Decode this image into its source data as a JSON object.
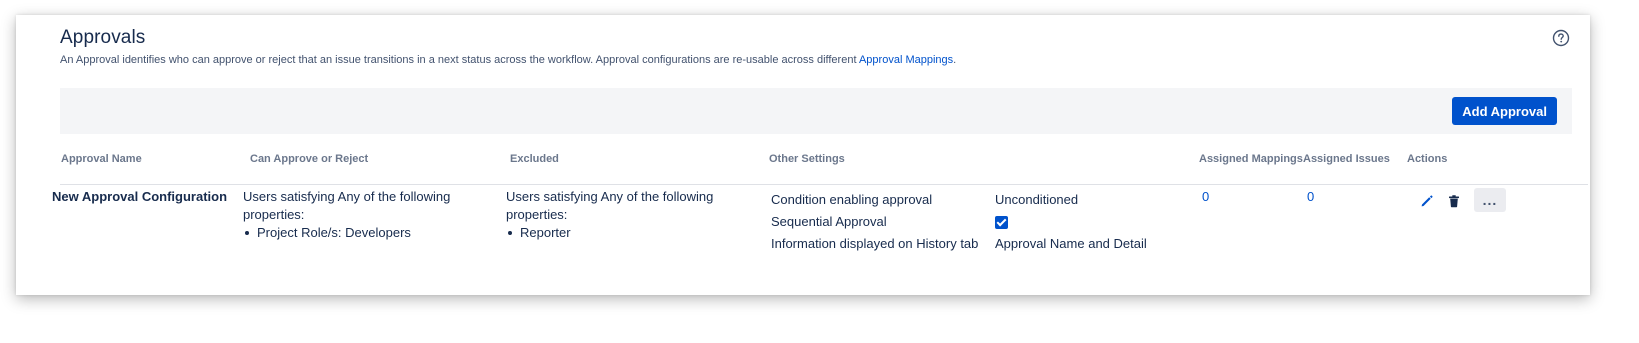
{
  "header": {
    "title": "Approvals",
    "description": "An Approval identifies who can approve or reject that an issue transitions in a next status across the workflow. Approval configurations are re-usable across different ",
    "description_link": "Approval Mappings",
    "description_end": "."
  },
  "toolbar": {
    "add_label": "Add Approval"
  },
  "table": {
    "columns": {
      "name": "Approval Name",
      "can_approve": "Can Approve or Reject",
      "excluded": "Excluded",
      "other_settings": "Other Settings",
      "assigned_mappings": "Assigned Mappings",
      "assigned_issues": "Assigned Issues",
      "actions": "Actions"
    },
    "rows": [
      {
        "name": "New Approval Configuration",
        "can_approve_intro": "Users satisfying Any of the following properties:",
        "can_approve_items": [
          "Project Role/s: Developers"
        ],
        "excluded_intro": "Users satisfying Any of the following properties:",
        "excluded_items": [
          "Reporter"
        ],
        "settings": [
          {
            "key": "Condition enabling approval",
            "value": "Unconditioned"
          },
          {
            "key": "Sequential Approval",
            "value": "",
            "checked": true
          },
          {
            "key": "Information displayed on History tab",
            "value": "Approval Name and Detail"
          }
        ],
        "assigned_mappings": "0",
        "assigned_issues": "0",
        "more_label": "..."
      }
    ]
  },
  "icons": {
    "help": "help-circle-icon",
    "edit": "pencil-icon",
    "delete": "trash-icon",
    "more": "more-horizontal-icon"
  },
  "colors": {
    "primary": "#0052cc",
    "text": "#172b4d",
    "muted": "#6b778c",
    "toolbar_bg": "#f4f5f7"
  }
}
